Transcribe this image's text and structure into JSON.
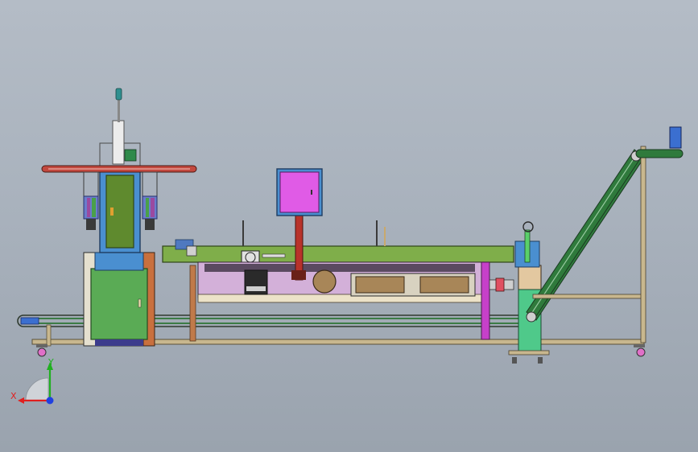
{
  "triad": {
    "y_label": "Y",
    "x_label": "X"
  },
  "colors": {
    "background_top": "#b4bcc6",
    "background_bottom": "#9aa3ae",
    "frame_green": "#6fa64a",
    "panel_magenta": "#e05be6",
    "cabinet_green": "#5aab55",
    "conveyor_green": "#2f7a3c",
    "column_blue": "#4a8fd0",
    "support_red": "#b8322a",
    "pillar_magenta": "#c640c9",
    "stand_green": "#4fc98a",
    "axis_x": "#e02020",
    "axis_y": "#20b020",
    "axis_z": "#2040e0"
  }
}
